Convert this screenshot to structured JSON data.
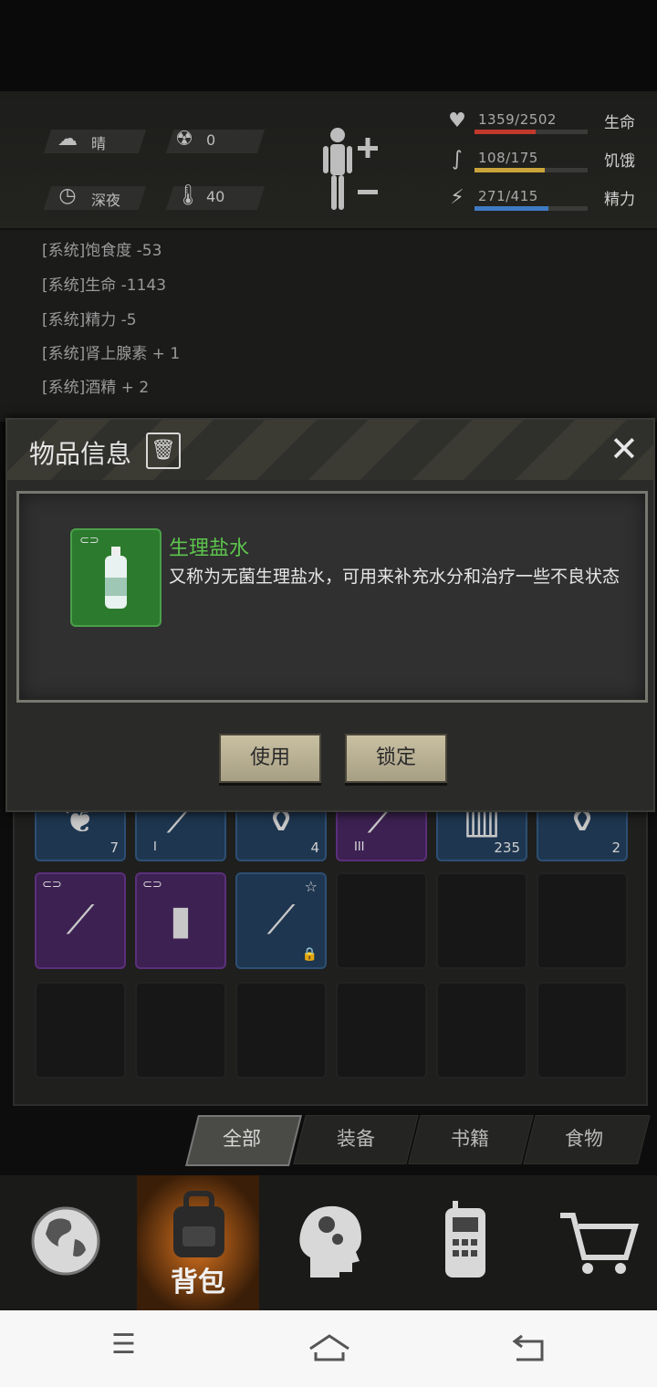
{
  "hud": {
    "weather": "晴",
    "radiation": "0",
    "time_of_day": "深夜",
    "temperature": "40",
    "stats": [
      {
        "label": "生命",
        "value": "1359/2502",
        "fraction": 0.543,
        "color": "#c0392b",
        "icon": "heart-icon"
      },
      {
        "label": "饥饿",
        "value": "108/175",
        "fraction": 0.617,
        "color": "#c9a43a",
        "icon": "stomach-icon"
      },
      {
        "label": "精力",
        "value": "271/415",
        "fraction": 0.653,
        "color": "#3f7bc4",
        "icon": "energy-icon"
      }
    ]
  },
  "log": [
    "[系统]饱食度 -53",
    "[系统]生命 -1143",
    "[系统]精力 -5",
    "[系统]肾上腺素 + 1",
    "[系统]酒精 + 2"
  ],
  "modal": {
    "title": "物品信息",
    "item_name": "生理盐水",
    "item_desc": "又称为无菌生理盐水，可用来补充水分和治疗一些不良状态",
    "use_label": "使用",
    "lock_label": "锁定"
  },
  "inventory": {
    "row1": [
      {
        "rarity": "blue",
        "count": "7",
        "icon": "meat-icon"
      },
      {
        "rarity": "blue",
        "count": "",
        "tier": "I",
        "icon": "knife-icon"
      },
      {
        "rarity": "blue",
        "count": "4",
        "icon": "saline-bottle-icon"
      },
      {
        "rarity": "purple",
        "count": "",
        "tier": "III",
        "icon": "weapon-icon"
      },
      {
        "rarity": "blue",
        "count": "235",
        "icon": "ammo-icon"
      },
      {
        "rarity": "blue",
        "count": "2",
        "icon": "bottle-icon"
      }
    ],
    "row2": [
      {
        "rarity": "purple",
        "icon": "syringe-icon",
        "linked": true
      },
      {
        "rarity": "purple",
        "icon": "canister-icon",
        "linked": true
      },
      {
        "rarity": "blue",
        "icon": "spear-icon",
        "starred": true,
        "locked": true
      },
      {
        "rarity": "empty"
      },
      {
        "rarity": "empty"
      },
      {
        "rarity": "empty"
      }
    ]
  },
  "tabs": [
    "全部",
    "装备",
    "书籍",
    "食物"
  ],
  "active_tab": "全部",
  "nav": {
    "bag_label": "背包",
    "items": [
      "globe-icon",
      "backpack-icon",
      "mind-icon",
      "radio-icon",
      "cart-icon"
    ]
  }
}
